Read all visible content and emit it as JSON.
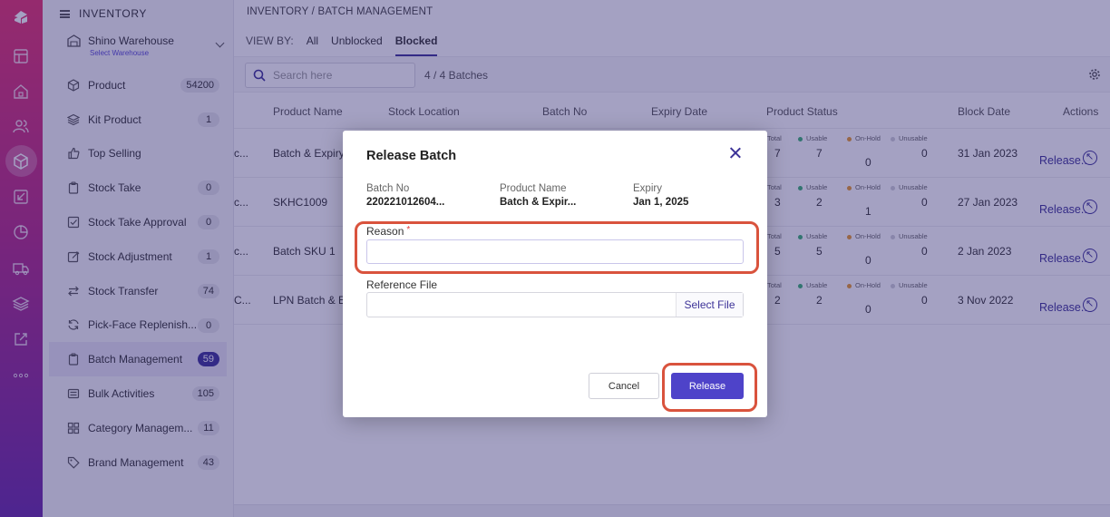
{
  "sidebar": {
    "header": "INVENTORY",
    "warehouse": {
      "name": "Shino Warehouse",
      "sub": "Select Warehouse"
    },
    "items": [
      {
        "label": "Product",
        "badge": "54200",
        "icon": "cube-icon"
      },
      {
        "label": "Kit Product",
        "badge": "1",
        "icon": "layers-icon"
      },
      {
        "label": "Top Selling",
        "badge": "",
        "icon": "thumbs-up-icon"
      },
      {
        "label": "Stock Take",
        "badge": "0",
        "icon": "clipboard-icon"
      },
      {
        "label": "Stock Take Approval",
        "badge": "0",
        "icon": "checkbox-icon"
      },
      {
        "label": "Stock Adjustment",
        "badge": "1",
        "icon": "edit-icon"
      },
      {
        "label": "Stock Transfer",
        "badge": "74",
        "icon": "transfer-icon"
      },
      {
        "label": "Pick-Face Replenish...",
        "badge": "0",
        "icon": "refresh-icon"
      },
      {
        "label": "Batch Management",
        "badge": "59",
        "icon": "clipboard-icon",
        "active": true
      },
      {
        "label": "Bulk Activities",
        "badge": "105",
        "icon": "list-icon"
      },
      {
        "label": "Category Managem...",
        "badge": "11",
        "icon": "grid-icon"
      },
      {
        "label": "Brand Management",
        "badge": "43",
        "icon": "tag-icon"
      }
    ]
  },
  "main": {
    "breadcrumb": "INVENTORY  /  BATCH MANAGEMENT",
    "viewby": {
      "label": "VIEW BY:",
      "tabs": [
        "All",
        "Unblocked",
        "Blocked"
      ],
      "active": "Blocked"
    },
    "search": {
      "placeholder": "Search here"
    },
    "count": "4 / 4 Batches",
    "columns": [
      "Product Name",
      "Stock Location",
      "Batch No",
      "Expiry Date",
      "Product Status",
      "Block Date",
      "Actions"
    ],
    "status_labels": {
      "total": "Total",
      "usable": "Usable",
      "onhold": "On-Hold",
      "unusable": "Unusable"
    },
    "rows": [
      {
        "prefix": "c...",
        "product": "Batch & Expiry",
        "total": "7",
        "usable": "7",
        "onhold": "0",
        "unusable": "0",
        "block_date": "31 Jan 2023",
        "action": "Release.."
      },
      {
        "prefix": "c...",
        "product": "SKHC1009",
        "total": "3",
        "usable": "2",
        "onhold": "1",
        "unusable": "0",
        "block_date": "27 Jan 2023",
        "action": "Release.."
      },
      {
        "prefix": "c...",
        "product": "Batch SKU 1",
        "total": "5",
        "usable": "5",
        "onhold": "0",
        "unusable": "0",
        "block_date": "2 Jan 2023",
        "action": "Release.."
      },
      {
        "prefix": "C...",
        "product": "LPN Batch & Ex",
        "total": "2",
        "usable": "2",
        "onhold": "0",
        "unusable": "0",
        "block_date": "3 Nov 2022",
        "action": "Release.."
      }
    ]
  },
  "modal": {
    "title": "Release Batch",
    "batch_no_label": "Batch No",
    "batch_no": "220221012604...",
    "product_name_label": "Product Name",
    "product_name": "Batch & Expir...",
    "expiry_label": "Expiry",
    "expiry": "Jan 1, 2025",
    "reason_label": "Reason",
    "reason_required": "*",
    "reason_value": "",
    "reference_label": "Reference File",
    "select_file": "Select File",
    "cancel": "Cancel",
    "release": "Release"
  },
  "colors": {
    "accent": "#4e43c9",
    "highlight": "#d9533d",
    "rail_top": "#e6336e",
    "rail_bottom": "#6a2aa8"
  }
}
